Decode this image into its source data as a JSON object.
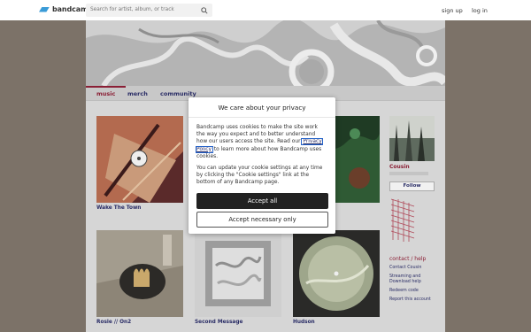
{
  "topbar": {
    "logo_text": "bandcamp",
    "search_placeholder": "Search for artist, album, or track",
    "signup": "sign up",
    "login": "log in"
  },
  "tabs": [
    {
      "label": "music",
      "active": true
    },
    {
      "label": "merch",
      "active": false
    },
    {
      "label": "community",
      "active": false
    }
  ],
  "albums": [
    {
      "title": "Wake The Town"
    },
    {
      "title": "Rosie // On2"
    },
    {
      "title": "Second Message"
    },
    {
      "title": "Hudson"
    }
  ],
  "artist": {
    "name": "Cousin",
    "follow_label": "Follow"
  },
  "sidebar": {
    "contact_help": "contact / help",
    "links": [
      "Contact Cousin",
      "Streaming and Download help",
      "Redeem code",
      "Report this account"
    ]
  },
  "modal": {
    "title": "We care about your privacy",
    "p1_before": "Bandcamp uses cookies to make the site work the way you expect and to better understand how our users access the site. Read our ",
    "p1_link": "Privacy Policy",
    "p1_after": " to learn more about how Bandcamp uses cookies.",
    "p2": "You can update your cookie settings at any time by clicking the \"Cookie settings\" link at the bottom of any Bandcamp page.",
    "accept_all": "Accept all",
    "accept_necessary": "Accept necessary only"
  },
  "colors": {
    "page_bg": "#7c7268",
    "link_navy": "#2a2d66",
    "accent_maroon": "#8a1f35",
    "logo_blue": "#3a9bd7"
  }
}
